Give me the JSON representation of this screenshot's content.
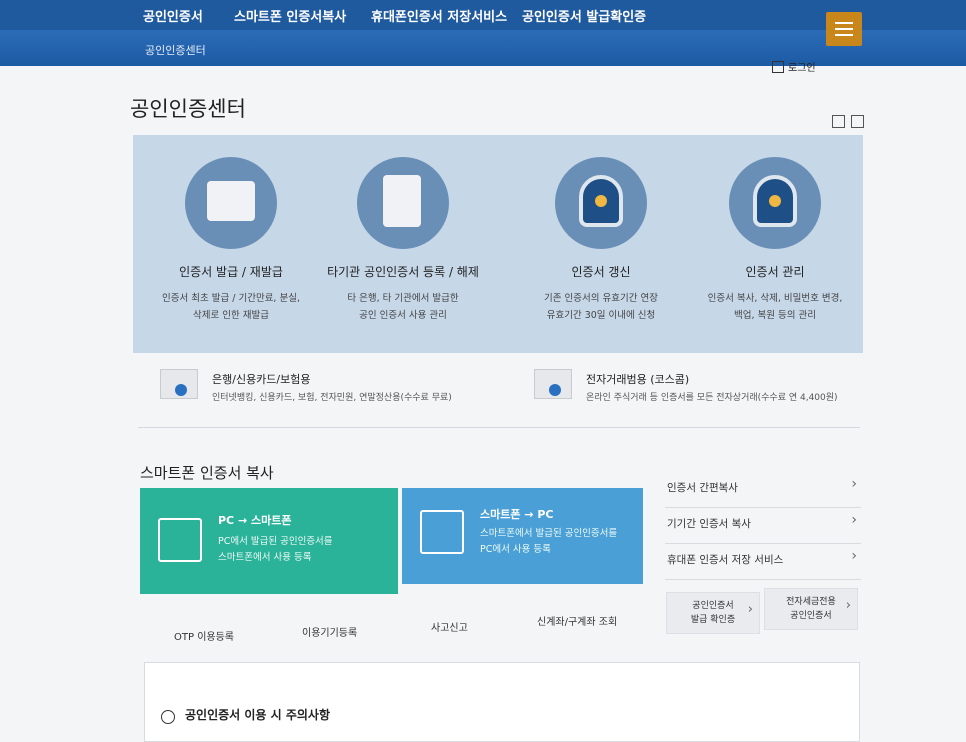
{
  "nav": {
    "items": [
      "공인인증서",
      "스마트폰 인증서복사",
      "휴대폰인증서 저장서비스",
      "공인인증서 발급확인증"
    ],
    "breadcrumb": "공인인증센터",
    "login": "로그인"
  },
  "page": {
    "title": "공인인증센터"
  },
  "features": [
    {
      "title": "인증서 발급 / 재발급",
      "desc1": "인증서 최초 발급 / 기간만료, 분실,",
      "desc2": "삭제로 인한 재발급"
    },
    {
      "title": "타기관 공인인증서 등록 / 해제",
      "desc1": "타 은행, 타 기관에서 발급한",
      "desc2": "공인 인증서 사용 관리"
    },
    {
      "title": "인증서 갱신",
      "desc1": "기존 인증서의 유효기간 연장",
      "desc2": "유효기간 30일 이내에 신청"
    },
    {
      "title": "인증서 관리",
      "desc1": "인증서 복사, 삭제, 비밀번호 변경,",
      "desc2": "백업, 복원 등의 관리"
    }
  ],
  "usage": [
    {
      "title": "은행/신용카드/보험용",
      "desc": "인터넷뱅킹, 신용카드, 보험, 전자민원, 연말정산용(수수료 무료)"
    },
    {
      "title": "전자거래범용 (코스콤)",
      "desc": "온라인 주식거래 등 인증서를 모든 전자상거래(수수료 연 4,400원)"
    }
  ],
  "smartphone": {
    "title": "스마트폰 인증서 복사",
    "pc_to_phone": {
      "title": "PC → 스마트폰",
      "desc1": "PC에서 발급된 공인인증서를",
      "desc2": "스마트폰에서 사용 등록"
    },
    "phone_to_pc": {
      "title": "스마트폰 → PC",
      "desc1": "스마트폰에서 발급된 공인인증서를",
      "desc2": "PC에서 사용 등록"
    },
    "links": [
      "인증서 간편복사",
      "기기간 인증서 복사",
      "휴대폰 인증서 저장 서비스"
    ]
  },
  "quick": {
    "items": [
      "OTP 이용등록",
      "이용기기등록",
      "사고신고",
      "신계좌/구계좌 조회"
    ],
    "box1": [
      "공인인증서",
      "발급 확인증"
    ],
    "box2": [
      "전자세금전용",
      "공인인증서"
    ]
  },
  "notice": {
    "title": "공인인증서 이용 시 주의사항"
  },
  "colors": {
    "nav": "#1f5a9e",
    "accent": "#c8861b",
    "teal": "#2bb39a",
    "blue": "#4aa0d6"
  }
}
